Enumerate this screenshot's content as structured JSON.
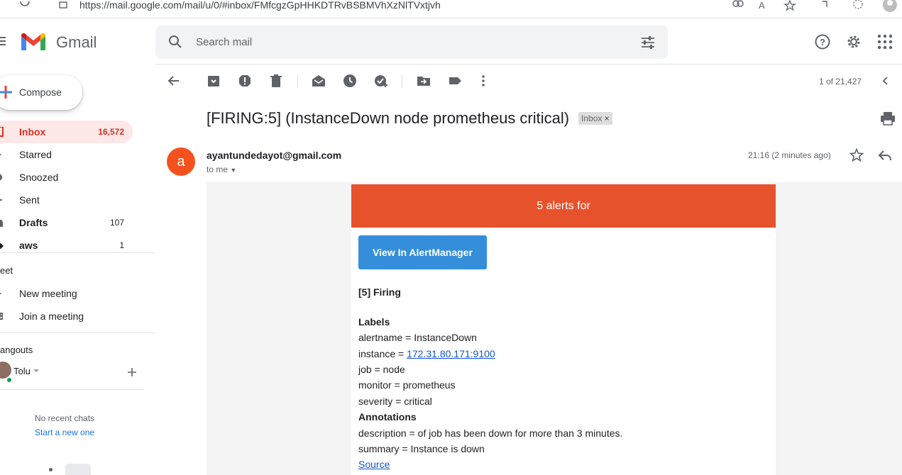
{
  "browser": {
    "url": "https://mail.google.com/mail/u/0/#inbox/FMfcgzGpHHKDTRvBSBMVhXzNlTVxtjvh"
  },
  "header": {
    "app_name": "Gmail",
    "search_placeholder": "Search mail"
  },
  "sidebar": {
    "compose_label": "Compose",
    "items": [
      {
        "label": "Inbox",
        "count": "16,572"
      },
      {
        "label": "Starred",
        "count": ""
      },
      {
        "label": "Snoozed",
        "count": ""
      },
      {
        "label": "Sent",
        "count": ""
      },
      {
        "label": "Drafts",
        "count": "107"
      },
      {
        "label": "aws",
        "count": "1"
      }
    ],
    "meet": {
      "title": "eet",
      "new_meeting": "New meeting",
      "join_meeting": "Join a meeting"
    },
    "hangouts": {
      "title": "angouts",
      "user": "Tolu",
      "no_chats": "No recent chats",
      "start_new": "Start a new one"
    }
  },
  "toolbar": {
    "pager": "1 of 21,427"
  },
  "email": {
    "subject": "[FIRING:5] (InstanceDown node prometheus critical)",
    "label_chip": "Inbox",
    "avatar_letter": "a",
    "sender": "ayantundedayot@gmail.com",
    "to": "to me",
    "time": "21:16 (2 minutes ago)",
    "banner": "5 alerts for",
    "button": "View In AlertManager",
    "firing": "[5] Firing",
    "labels_heading": "Labels",
    "alertname": "alertname = InstanceDown",
    "instance_prefix": "instance = ",
    "instance_link": "172.31.80.171:9100",
    "job": "job = node",
    "monitor": "monitor = prometheus",
    "severity": "severity = critical",
    "annotations_heading": "Annotations",
    "description": "description = of job has been down for more than 3 minutes.",
    "summary": "summary = Instance is down",
    "source": "Source"
  },
  "colors": {
    "banner": "#e6522c",
    "button": "#348eda",
    "active_nav": "#fce8e6",
    "active_text": "#d93025",
    "avatar": "#f4511e"
  }
}
